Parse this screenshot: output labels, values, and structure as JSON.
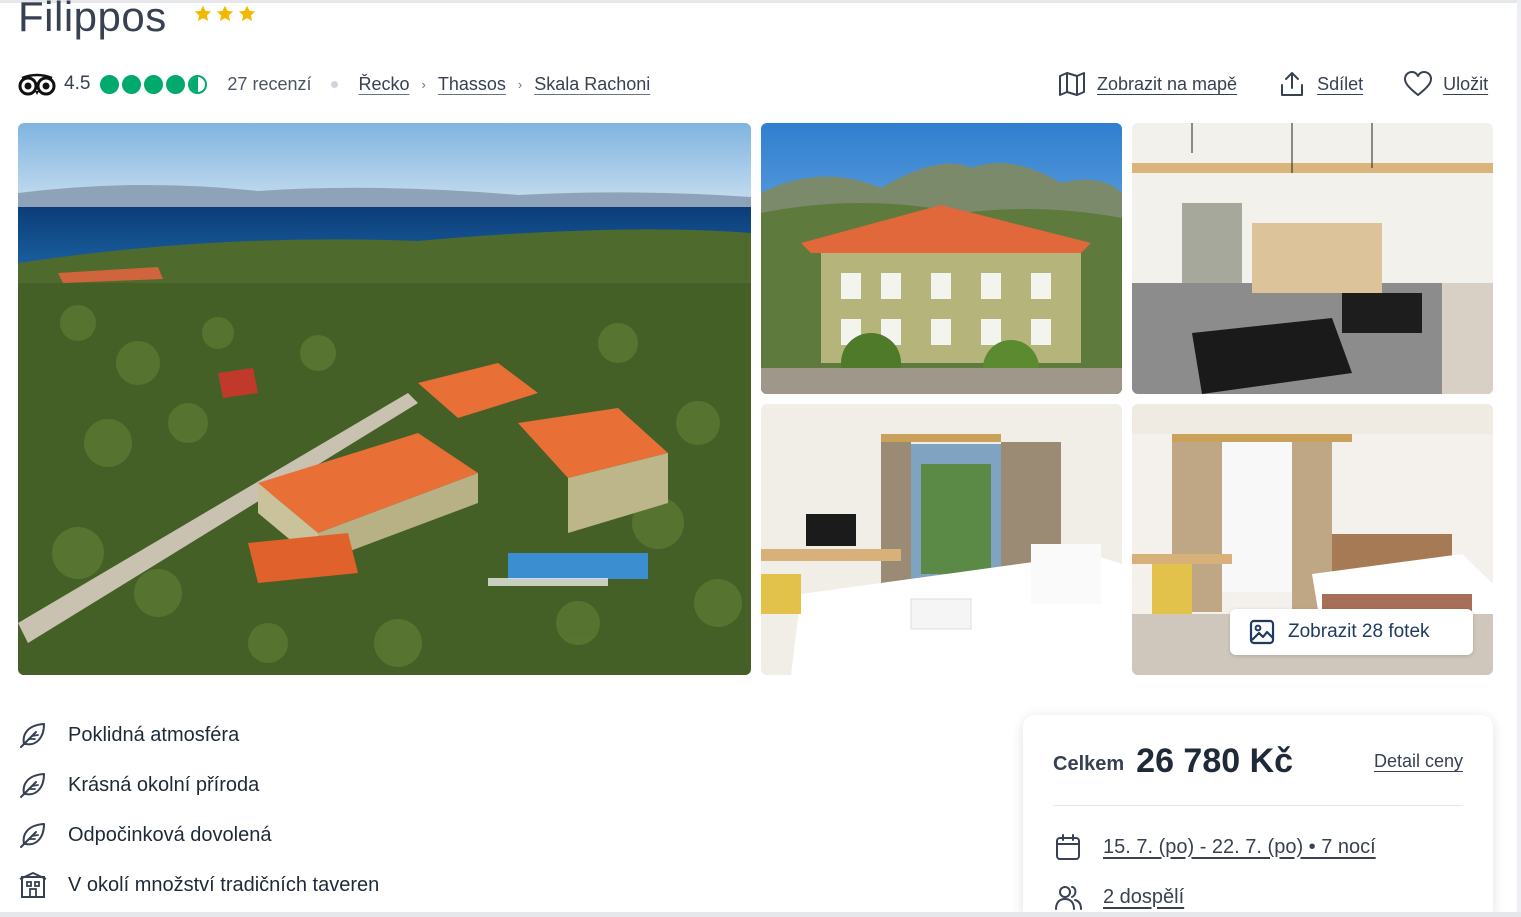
{
  "hotel": {
    "name": "Filippos",
    "stars": 3
  },
  "rating": {
    "value": "4.5",
    "bubbles": 4.5,
    "reviews": "27 recenzí",
    "brand_color": "#00aa6c"
  },
  "breadcrumb": [
    "Řecko",
    "Thassos",
    "Skala Rachoni"
  ],
  "actions": {
    "map": "Zobrazit na mapě",
    "share": "Sdílet",
    "save": "Uložit"
  },
  "gallery": {
    "show_all": "Zobrazit 28 fotek"
  },
  "features": [
    {
      "icon": "leaf-icon",
      "text": "Poklidná atmosféra"
    },
    {
      "icon": "leaf-icon",
      "text": "Krásná okolní příroda"
    },
    {
      "icon": "leaf-icon",
      "text": "Odpočinková dovolená"
    },
    {
      "icon": "building-icon",
      "text": "V okolí množství tradičních taveren"
    }
  ],
  "price": {
    "label": "Celkem",
    "value": "26 780 Kč",
    "detail": "Detail ceny",
    "dates": "15. 7. (po) - 22. 7. (po) • 7 nocí",
    "guests": "2 dospělí"
  },
  "colors": {
    "star": "#f5b800",
    "text_dark": "#1f2937",
    "accent_navy": "#1e3a5f"
  }
}
